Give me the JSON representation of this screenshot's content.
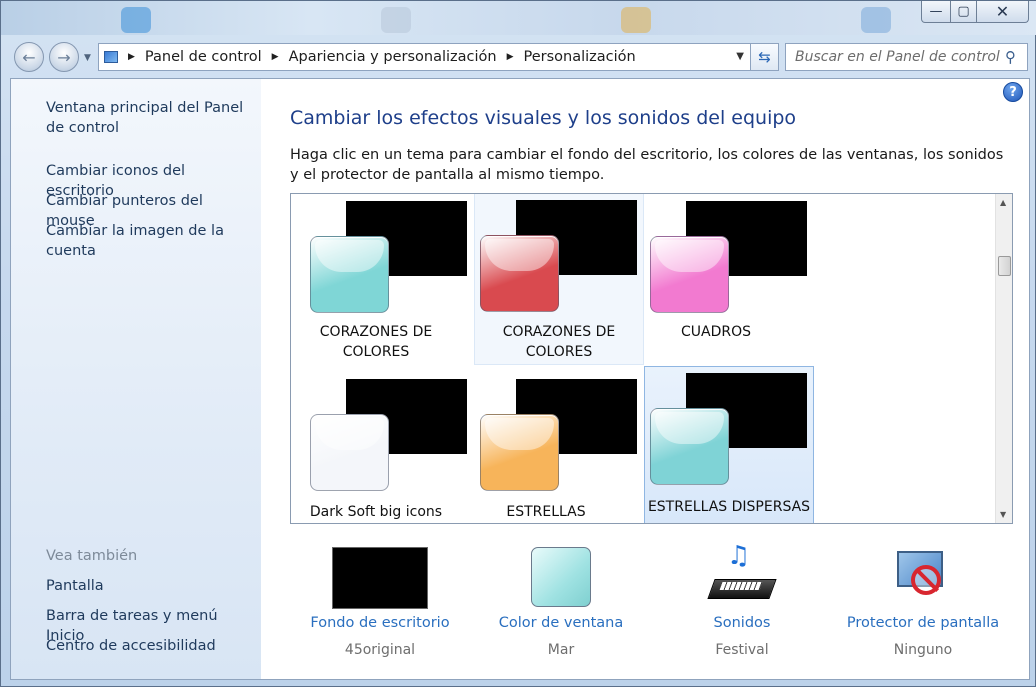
{
  "window": {
    "minimize_glyph": "—",
    "maximize_glyph": "▢",
    "close_glyph": "✕"
  },
  "nav": {
    "back_icon": "back-arrow-icon",
    "forward_icon": "forward-arrow-icon",
    "breadcrumbs": [
      "Panel de control",
      "Apariencia y personalización",
      "Personalización"
    ],
    "search_placeholder": "Buscar en el Panel de control"
  },
  "sidebar": {
    "links": [
      "Ventana principal del Panel de control",
      "Cambiar iconos del escritorio",
      "Cambiar punteros del mouse",
      "Cambiar la imagen de la cuenta"
    ],
    "see_also_title": "Vea también",
    "see_also": [
      "Pantalla",
      "Barra de tareas y menú Inicio",
      "Centro de accesibilidad"
    ]
  },
  "main": {
    "heading": "Cambiar los efectos visuales y los sonidos del equipo",
    "description": "Haga clic en un tema para cambiar el fondo del escritorio, los colores de las ventanas, los sonidos y el protector de pantalla al mismo tiempo.",
    "help_glyph": "?",
    "themes": [
      {
        "name": "CORAZONES DE COLORES",
        "color": "#7fd6d6",
        "state": "normal"
      },
      {
        "name": "CORAZONES DE COLORES",
        "color": "#d94a4f",
        "state": "hover"
      },
      {
        "name": "CUADROS",
        "color": "#f27ad0",
        "state": "normal"
      },
      {
        "name": "Dark Soft big icons",
        "color": "#f4f6fa",
        "state": "normal"
      },
      {
        "name": "ESTRELLAS",
        "color": "#f7b45a",
        "state": "normal"
      },
      {
        "name": "ESTRELLAS DISPERSAS",
        "color": "#7fd3d6",
        "state": "selected"
      }
    ],
    "settings": [
      {
        "name": "Fondo de escritorio",
        "value": "45original",
        "icon": "desktop-background-icon"
      },
      {
        "name": "Color de ventana",
        "value": "Mar",
        "icon": "window-color-icon"
      },
      {
        "name": "Sonidos",
        "value": "Festival",
        "icon": "music-keyboard-icon"
      },
      {
        "name": "Protector de pantalla",
        "value": "Ninguno",
        "icon": "screensaver-none-icon"
      }
    ]
  }
}
